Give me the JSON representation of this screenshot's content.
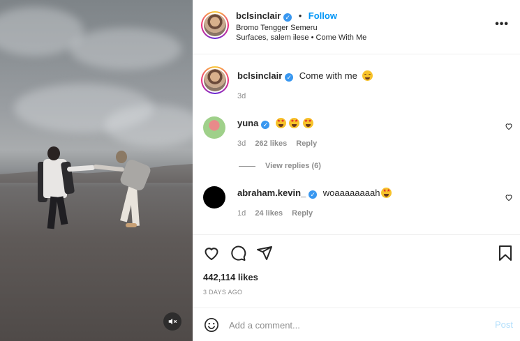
{
  "header": {
    "username": "bclsinclair",
    "separator": "•",
    "follow_label": "Follow",
    "location": "Bromo Tengger Semeru",
    "audio": "Surfaces, salem ilese • Come With Me"
  },
  "caption": {
    "username": "bclsinclair",
    "text": "Come with me",
    "age": "3d"
  },
  "comments": [
    {
      "username": "yuna",
      "age": "3d",
      "likes": "262 likes",
      "reply_label": "Reply",
      "view_replies": "View replies (6)"
    },
    {
      "username": "abraham.kevin_",
      "text": "woaaaaaaaah",
      "age": "1d",
      "likes": "24 likes",
      "reply_label": "Reply"
    }
  ],
  "stats": {
    "likes": "442,114 likes",
    "date": "3 DAYS AGO"
  },
  "add_comment": {
    "placeholder": "Add a comment...",
    "post_label": "Post"
  },
  "icons": {
    "more": "more-options-icon",
    "heart": "heart-icon",
    "comment": "comment-icon",
    "share": "share-icon",
    "bookmark": "bookmark-icon",
    "emoji": "emoji-icon",
    "mute": "mute-icon",
    "verified": "verified-badge-icon"
  },
  "colors": {
    "accent": "#0095f6",
    "verified": "#3897f0",
    "post_disabled": "#b2dffc"
  }
}
